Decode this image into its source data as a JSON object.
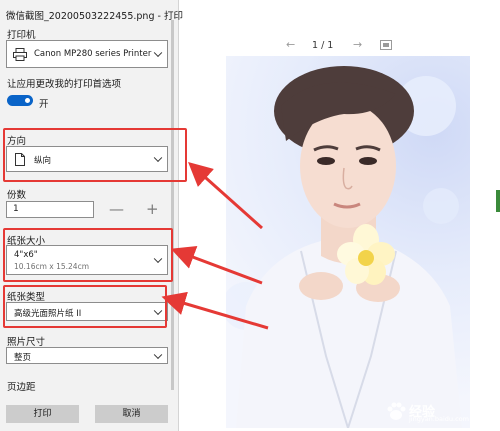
{
  "window": {
    "title": "微信截图_20200503222455.png - 打印"
  },
  "printer": {
    "label": "打印机",
    "value": "Canon MP280 series Printer"
  },
  "app_pref": {
    "label": "让应用更改我的打印首选项",
    "toggle_text": "开",
    "on": true
  },
  "orientation": {
    "label": "方向",
    "value": "纵向"
  },
  "copies": {
    "label": "份数",
    "value": "1",
    "minus": "—",
    "plus": "+"
  },
  "paper_size": {
    "label": "纸张大小",
    "value": "4\"x6\"",
    "sub": "10.16cm x 15.24cm"
  },
  "paper_type": {
    "label": "纸张类型",
    "value": "高级光面照片纸 II"
  },
  "photo_size": {
    "label": "照片尺寸",
    "value": "整页"
  },
  "margins": {
    "label": "页边距"
  },
  "buttons": {
    "print": "打印",
    "cancel": "取消"
  },
  "preview": {
    "page_indicator": "1 / 1",
    "prev": "←",
    "next": "→"
  },
  "watermark": {
    "text": "经验",
    "sub": "jingyan.baidu.com"
  },
  "colors": {
    "accent": "#0a64c8",
    "highlight_red": "#e53935"
  }
}
